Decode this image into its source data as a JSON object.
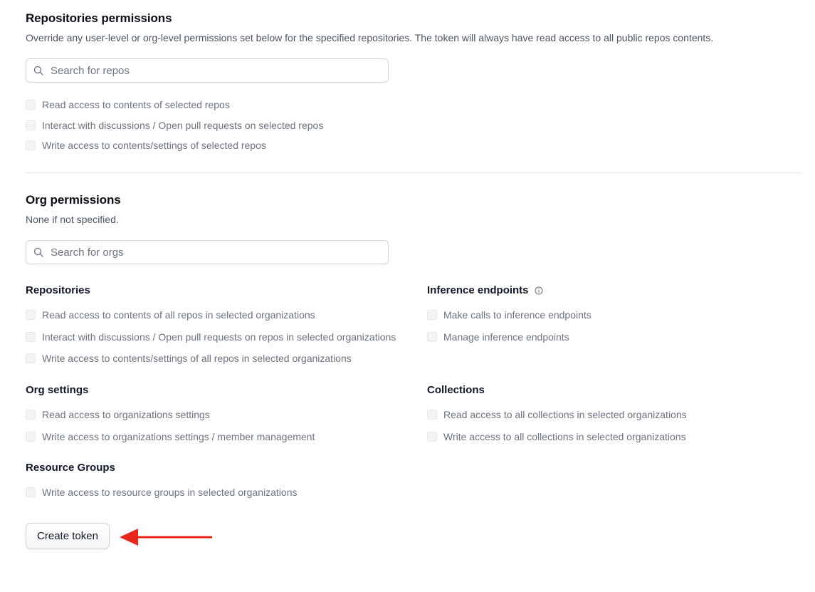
{
  "repos": {
    "title": "Repositories permissions",
    "description": "Override any user-level or org-level permissions set below for the specified repositories. The token will always have read access to all public repos contents.",
    "search_placeholder": "Search for repos",
    "options": [
      "Read access to contents of selected repos",
      "Interact with discussions / Open pull requests on selected repos",
      "Write access to contents/settings of selected repos"
    ]
  },
  "org": {
    "title": "Org permissions",
    "description": "None if not specified.",
    "search_placeholder": "Search for orgs",
    "repositories": {
      "title": "Repositories",
      "options": [
        "Read access to contents of all repos in selected organizations",
        "Interact with discussions / Open pull requests on repos in selected organizations",
        "Write access to contents/settings of all repos in selected organizations"
      ]
    },
    "inference": {
      "title": "Inference endpoints",
      "options": [
        "Make calls to inference endpoints",
        "Manage inference endpoints"
      ]
    },
    "settings": {
      "title": "Org settings",
      "options": [
        "Read access to organizations settings",
        "Write access to organizations settings / member management"
      ]
    },
    "collections": {
      "title": "Collections",
      "options": [
        "Read access to all collections in selected organizations",
        "Write access to all collections in selected organizations"
      ]
    },
    "resource_groups": {
      "title": "Resource Groups",
      "options": [
        "Write access to resource groups in selected organizations"
      ]
    }
  },
  "create_button": "Create token",
  "annotation_arrow_color": "#e8271a"
}
